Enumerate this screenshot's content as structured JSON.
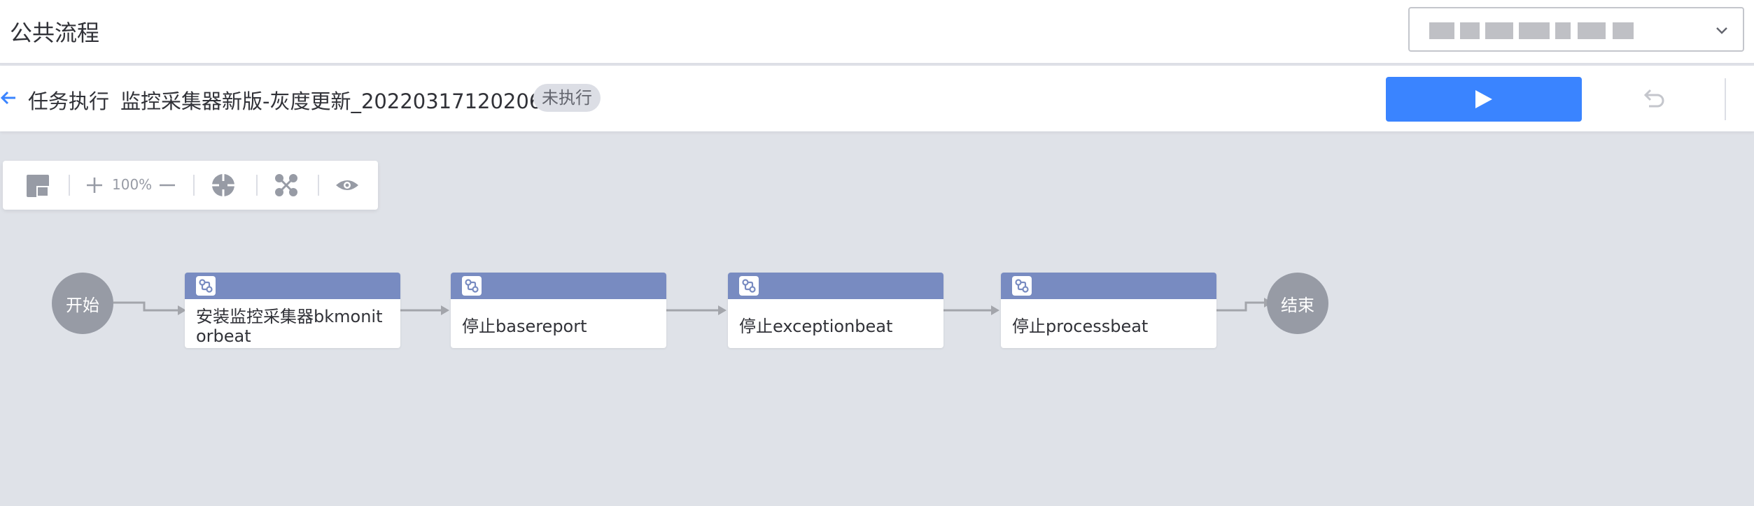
{
  "header": {
    "title": "公共流程"
  },
  "task": {
    "label": "任务执行",
    "name": "监控采集器新版-灰度更新_20220317120206",
    "status": "未执行"
  },
  "toolbar": {
    "zoom": "100%"
  },
  "flow": {
    "start_label": "开始",
    "end_label": "结束",
    "nodes": [
      {
        "label": "安装监控采集器bkmonitorbeat"
      },
      {
        "label": "停止basereport"
      },
      {
        "label": "停止exceptionbeat"
      },
      {
        "label": "停止processbeat"
      }
    ]
  },
  "colors": {
    "accent": "#3a84ff",
    "node_header": "#788bc1",
    "circle_node": "#979ba5",
    "canvas_bg": "#dfe2e8"
  }
}
